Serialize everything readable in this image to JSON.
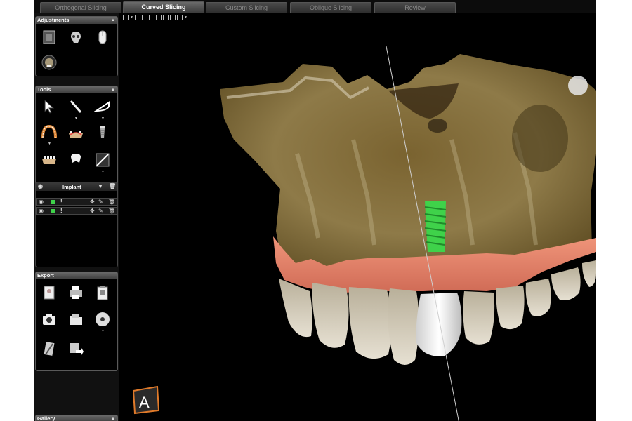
{
  "tabs": [
    {
      "label": "Orthogonal Slicing",
      "active": false
    },
    {
      "label": "Curved Slicing",
      "active": true
    },
    {
      "label": "Custom Slicing",
      "active": false
    },
    {
      "label": "Oblique Slicing",
      "active": false
    },
    {
      "label": "Review",
      "active": false
    }
  ],
  "panels": {
    "adjustments": {
      "title": "Adjustments",
      "tools": [
        "cube-volume-icon",
        "skull-icon",
        "mouse-icon",
        "skull-scan-icon"
      ]
    },
    "tools": {
      "title": "Tools",
      "tools": [
        "pointer-arrow-icon",
        "ruler-icon",
        "protractor-icon",
        "arch-curve-icon",
        "nerve-icon",
        "implant-icon",
        "jaw-icon",
        "tooth-icon",
        "slice-cut-icon"
      ]
    },
    "implant": {
      "title": "Implant",
      "rows": [
        {
          "color": "#3fd24a",
          "label": "!"
        },
        {
          "color": "#3fd24a",
          "label": "!"
        }
      ]
    },
    "export": {
      "title": "Export",
      "tools": [
        "report-icon",
        "printer-icon",
        "clipboard-icon",
        "camera-icon",
        "folder-icon",
        "cd-icon",
        "pdf-export-icon",
        "send-icon"
      ]
    },
    "gallery": {
      "title": "Gallery"
    }
  },
  "logo_letter": "A",
  "colors": {
    "implant": "#3fd24a",
    "gum": "#e47a60",
    "bone": "#8a7440",
    "crown": "#f0f0f0"
  }
}
